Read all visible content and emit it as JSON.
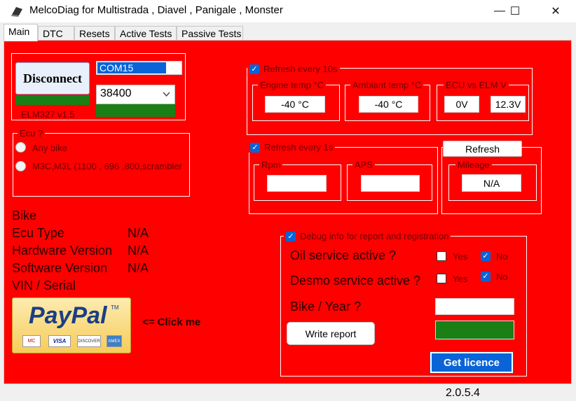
{
  "window": {
    "title": "MelcoDiag for Multistrada , Diavel , Panigale , Monster",
    "minimize_glyph": "—",
    "maximize_glyph": "☐",
    "close_glyph": "✕"
  },
  "tabs": [
    "Main",
    "DTC",
    "Resets",
    "Active Tests",
    "Passive Tests"
  ],
  "connection": {
    "disconnect_label": "Disconnect",
    "port": "COM15",
    "baud": "38400",
    "adapter": "ELM327 v1.5"
  },
  "ecu_group": {
    "title": "Ecu ?",
    "option_any": "Any bike",
    "option_m3c": "M3C,M3L (1100 , 696 ,800,scrambler"
  },
  "info": {
    "bike_label": "Bike",
    "ecu_type_label": "Ecu Type",
    "ecu_type_value": "N/A",
    "hardware_label": "Hardware Version",
    "hardware_value": "N/A",
    "software_label": "Software Version",
    "software_value": "N/A",
    "vin_label": "VIN / Serial"
  },
  "paypal": {
    "logo_text": "PayPal",
    "tm": "TM",
    "card_mastercard": "MC",
    "card_visa": "VISA",
    "card_discover": "DISCOVER",
    "card_amex": "AMEX",
    "click_me": "<= Click me"
  },
  "refresh10": {
    "checkbox_label": "Refresh every 10s",
    "engine_temp_label": "Engine temp °C",
    "engine_temp_value": "-40 °C",
    "ambiant_temp_label": "Ambiant temp °C",
    "ambiant_temp_value": "-40 °C",
    "ecu_vs_elm_label": "ECU vs ELM V",
    "ecu_v": "0V",
    "elm_v": "12.3V"
  },
  "refresh1": {
    "checkbox_label": "Refresh every 1s",
    "rpm_label": "Rpm",
    "rpm_value": "",
    "aps_label": "APS",
    "aps_value": ""
  },
  "mileage": {
    "refresh_label": "Refresh",
    "mileage_label": "Mileage",
    "mileage_value": "N/A"
  },
  "debug": {
    "checkbox_label": "Debug info for report and registration",
    "oil_label": "Oil service active ?",
    "desmo_label": "Desmo service active ?",
    "yes": "Yes",
    "no": "No",
    "bike_year_label": "Bike / Year ?",
    "bike_year_value": "",
    "write_report_label": "Write report",
    "get_licence_label": "Get licence"
  },
  "status": {
    "version": "2.0.5.4"
  },
  "colors": {
    "panel": "#ff0000",
    "green": "#1a7f15",
    "accent": "#0a64d8"
  }
}
